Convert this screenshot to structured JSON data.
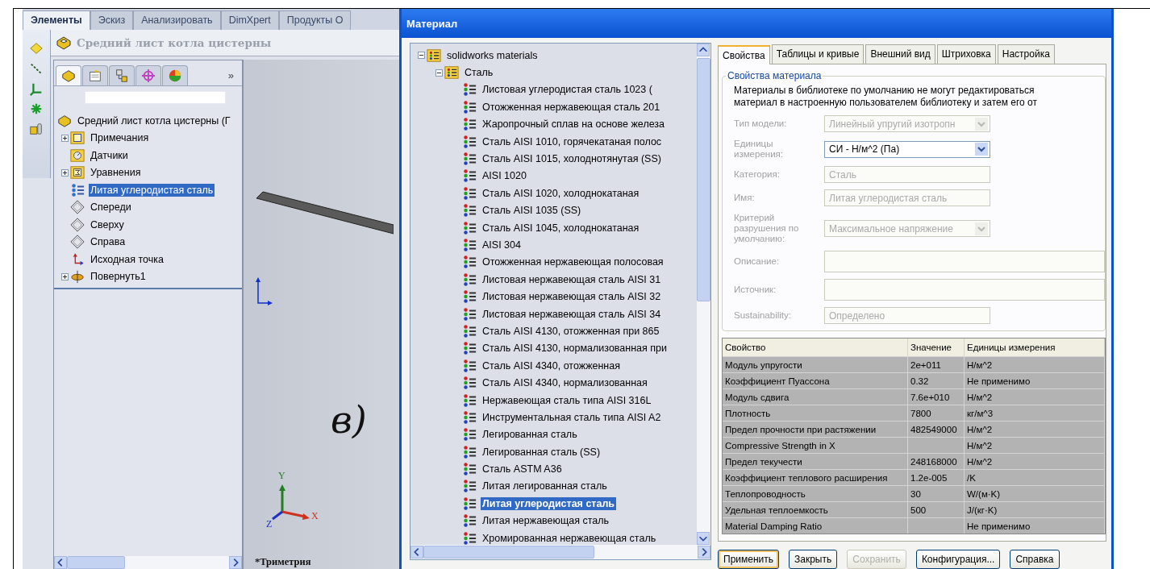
{
  "app_tabs": [
    {
      "label": "Элементы",
      "selected": true
    },
    {
      "label": "Эскиз",
      "selected": false
    },
    {
      "label": "Анализировать",
      "selected": false
    },
    {
      "label": "DimXpert",
      "selected": false
    },
    {
      "label": "Продукты О",
      "selected": false
    }
  ],
  "part_title": "Средний лист котла цистерны",
  "manager_tabs": [
    {
      "kind": "feature",
      "selected": true
    },
    {
      "kind": "property",
      "selected": false
    },
    {
      "kind": "config",
      "selected": false
    },
    {
      "kind": "dimxpert",
      "selected": false
    },
    {
      "kind": "display",
      "selected": false
    }
  ],
  "manager_more": "»",
  "feature_tree": {
    "root": "Средний лист котла цистерны  (Г",
    "items": [
      {
        "label": "Примечания",
        "kind": "notes",
        "expanded": false,
        "selected": false
      },
      {
        "label": "Датчики",
        "kind": "sensors",
        "selected": false
      },
      {
        "label": "Уравнения",
        "kind": "equations",
        "expanded": false,
        "selected": false
      },
      {
        "label": "Литая углеродистая сталь",
        "kind": "material",
        "selected": true
      },
      {
        "label": "Спереди",
        "kind": "plane",
        "selected": false
      },
      {
        "label": "Сверху",
        "kind": "plane",
        "selected": false
      },
      {
        "label": "Справа",
        "kind": "plane",
        "selected": false
      },
      {
        "label": "Исходная точка",
        "kind": "origin",
        "selected": false
      },
      {
        "label": "Повернуть1",
        "kind": "revolve",
        "expanded": false,
        "selected": false
      }
    ]
  },
  "viewport": {
    "figure_label": "в)",
    "view_name": "*Триметрия",
    "triad_labels": [
      "Y",
      "X",
      "Z"
    ]
  },
  "dialog": {
    "title": "Материал",
    "library": [
      {
        "label": "solidworks materials",
        "kind": "library",
        "expanded": true,
        "selected": false,
        "children": [
          {
            "label": "Сталь",
            "kind": "folder",
            "expanded": true,
            "selected": false,
            "children": [
              {
                "label": "Листовая углеродистая сталь 1023 (",
                "kind": "material",
                "selected": false
              },
              {
                "label": "Отожженная нержавеющая сталь 201",
                "kind": "material",
                "selected": false
              },
              {
                "label": "Жаропрочный сплав на основе железа",
                "kind": "material",
                "selected": false
              },
              {
                "label": "Сталь AISI 1010, горячекатаная полос",
                "kind": "material",
                "selected": false
              },
              {
                "label": "Сталь AISI 1015, холоднотянутая (SS)",
                "kind": "material",
                "selected": false
              },
              {
                "label": "AISI 1020",
                "kind": "material",
                "selected": false
              },
              {
                "label": "Сталь AISI 1020, холоднокатаная",
                "kind": "material",
                "selected": false
              },
              {
                "label": "Сталь AISI 1035 (SS)",
                "kind": "material",
                "selected": false
              },
              {
                "label": "Сталь AISI 1045, холоднокатаная",
                "kind": "material",
                "selected": false
              },
              {
                "label": "AISI 304",
                "kind": "material",
                "selected": false
              },
              {
                "label": "Отожженная нержавеющая полосовая",
                "kind": "material",
                "selected": false
              },
              {
                "label": "Листовая нержавеющая сталь AISI 31",
                "kind": "material",
                "selected": false
              },
              {
                "label": "Листовая нержавеющая сталь AISI 32",
                "kind": "material",
                "selected": false
              },
              {
                "label": "Листовая нержавеющая сталь AISI 34",
                "kind": "material",
                "selected": false
              },
              {
                "label": "Сталь AISI 4130, отожженная при 865",
                "kind": "material",
                "selected": false
              },
              {
                "label": "Сталь AISI 4130, нормализованная при",
                "kind": "material",
                "selected": false
              },
              {
                "label": "Сталь AISI 4340, отожженная",
                "kind": "material",
                "selected": false
              },
              {
                "label": "Сталь AISI 4340, нормализованная",
                "kind": "material",
                "selected": false
              },
              {
                "label": "Нержавеющая сталь типа AISI 316L",
                "kind": "material",
                "selected": false
              },
              {
                "label": "Инструментальная сталь типа AISI A2",
                "kind": "material",
                "selected": false
              },
              {
                "label": "Легированная сталь",
                "kind": "material",
                "selected": false
              },
              {
                "label": "Легированная сталь (SS)",
                "kind": "material",
                "selected": false
              },
              {
                "label": "Сталь ASTM A36",
                "kind": "material",
                "selected": false
              },
              {
                "label": "Литая легированная сталь",
                "kind": "material",
                "selected": false
              },
              {
                "label": "Литая углеродистая сталь",
                "kind": "material",
                "selected": true
              },
              {
                "label": "Литая нержавеющая сталь",
                "kind": "material",
                "selected": false
              },
              {
                "label": "Хромированная нержавеющая сталь",
                "kind": "material",
                "selected": false
              }
            ]
          }
        ]
      }
    ],
    "tabs": [
      {
        "label": "Свойства",
        "selected": true
      },
      {
        "label": "Таблицы и кривые",
        "selected": false
      },
      {
        "label": "Внешний вид",
        "selected": false
      },
      {
        "label": "Штриховка",
        "selected": false
      },
      {
        "label": "Настройка",
        "selected": false
      }
    ],
    "group_title": "Свойства материала",
    "notice": [
      "Материалы в библиотеке по умолчанию не могут редактироваться",
      "материал в настроенную пользователем библиотеку и затем его от"
    ],
    "fields": [
      {
        "label": "Тип модели:",
        "value": "Линейный упругий изотропн",
        "kind": "select",
        "disabled": true
      },
      {
        "label": "Единицы измерения:",
        "value": "СИ - Н/м^2 (Па)",
        "kind": "select",
        "disabled": false
      },
      {
        "label": "Категория:",
        "value": "Сталь",
        "kind": "text",
        "disabled": true
      },
      {
        "label": "Имя:",
        "value": "Литая углеродистая сталь",
        "kind": "text",
        "disabled": true
      },
      {
        "label": "Критерий разрушения по умолчанию:",
        "value": "Максимальное напряжение",
        "kind": "select",
        "disabled": true
      },
      {
        "label": "Описание:",
        "kind": "area",
        "disabled": true
      },
      {
        "label": "Источник:",
        "kind": "area",
        "disabled": true
      },
      {
        "label": "Sustainability:",
        "value": "Определено",
        "kind": "text",
        "disabled": true
      }
    ],
    "table": {
      "columns": [
        "Свойство",
        "Значение",
        "Единицы измерения"
      ],
      "rows": [
        {
          "property": "Модуль упругости",
          "value": "2e+011",
          "units": "Н/м^2"
        },
        {
          "property": "Коэффициент Пуассона",
          "value": "0.32",
          "units": "Не применимо"
        },
        {
          "property": "Модуль сдвига",
          "value": "7.6e+010",
          "units": "Н/м^2"
        },
        {
          "property": "Плотность",
          "value": "7800",
          "units": "кг/м^3"
        },
        {
          "property": "Предел прочности при растяжении",
          "value": "482549000",
          "units": "Н/м^2"
        },
        {
          "property": "Compressive Strength in X",
          "units": "Н/м^2"
        },
        {
          "property": "Предел текучести",
          "value": "248168000",
          "units": "Н/м^2"
        },
        {
          "property": "Коэффициент теплового расширения",
          "value": "1.2e-005",
          "units": "/K"
        },
        {
          "property": "Теплопроводность",
          "value": "30",
          "units": "W/(м·K)"
        },
        {
          "property": "Удельная теплоемкость",
          "value": "500",
          "units": "J/(кг·K)"
        },
        {
          "property": "Material Damping Ratio",
          "units": "Не применимо"
        }
      ]
    },
    "buttons": [
      {
        "label": "Применить",
        "default": true,
        "disabled": false
      },
      {
        "label": "Закрыть",
        "default": false,
        "disabled": false
      },
      {
        "label": "Сохранить",
        "default": false,
        "disabled": true
      },
      {
        "label": "Конфигурация...",
        "default": false,
        "disabled": false
      },
      {
        "label": "Справка",
        "default": false,
        "disabled": false
      }
    ]
  }
}
